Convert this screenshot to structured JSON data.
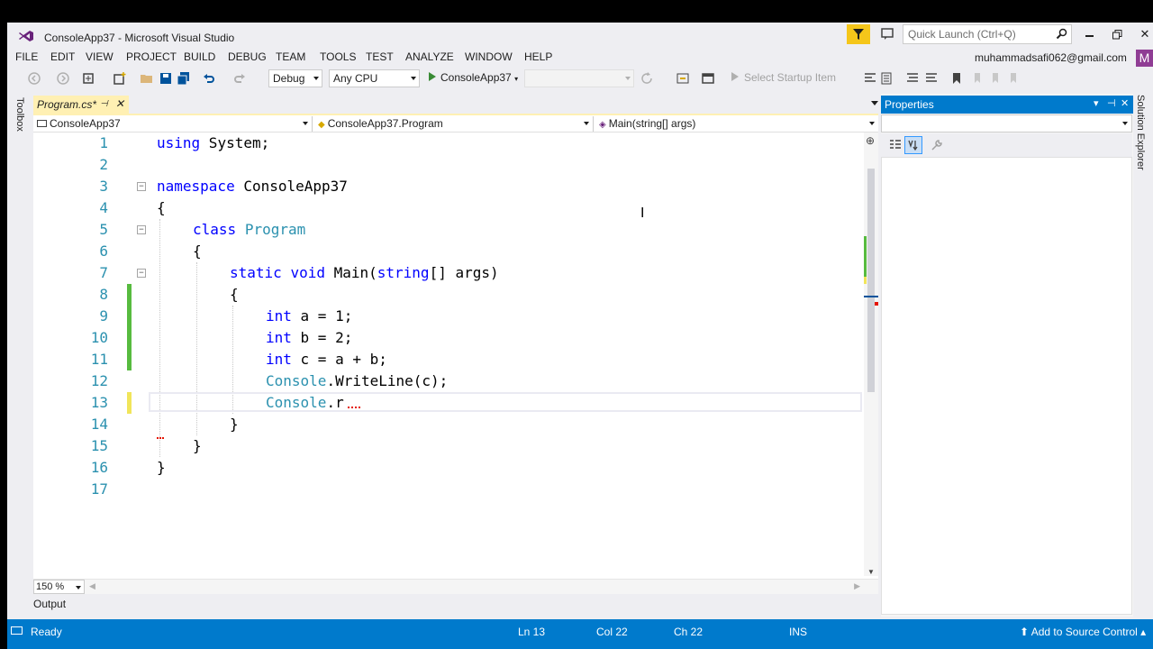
{
  "window": {
    "title": "ConsoleApp37 - Microsoft Visual Studio",
    "quick_launch_placeholder": "Quick Launch (Ctrl+Q)",
    "user_email": "muhammadsafi062@gmail.com",
    "avatar_letter": "M"
  },
  "menu": [
    "FILE",
    "EDIT",
    "VIEW",
    "PROJECT",
    "BUILD",
    "DEBUG",
    "TEAM",
    "TOOLS",
    "TEST",
    "ANALYZE",
    "WINDOW",
    "HELP"
  ],
  "toolbar": {
    "config": "Debug",
    "platform": "Any CPU",
    "start_label": "ConsoleApp37",
    "startup_item": "Select Startup Item"
  },
  "side_strip": {
    "toolbox": "Toolbox",
    "solution_explorer": "Solution Explorer"
  },
  "document_tab": {
    "label": "Program.cs*"
  },
  "navigation": {
    "project": "ConsoleApp37",
    "type": "ConsoleApp37.Program",
    "member": "Main(string[] args)"
  },
  "code_lines": [
    "using System;",
    "",
    "namespace ConsoleApp37",
    "{",
    "    class Program",
    "    {",
    "        static void Main(string[] args)",
    "        {",
    "            int a = 1;",
    "            int b = 2;",
    "            int c = a + b;",
    "            Console.WriteLine(c);",
    "            Console.r",
    "        }",
    "    }",
    "}",
    ""
  ],
  "line_numbers": [
    "1",
    "2",
    "3",
    "4",
    "5",
    "6",
    "7",
    "8",
    "9",
    "10",
    "11",
    "12",
    "13",
    "14",
    "15",
    "16",
    "17"
  ],
  "zoom": "150 %",
  "properties": {
    "title": "Properties"
  },
  "bottom_tab": "Output",
  "status": {
    "state": "Ready",
    "line": "Ln 13",
    "col": "Col 22",
    "ch": "Ch 22",
    "mode": "INS",
    "source_control": "Add to Source Control"
  },
  "colors": {
    "accent": "#007acc",
    "keyword": "#0000ff",
    "type": "#2b91af",
    "line_number": "#2b91af",
    "change_saved": "#57bb3f",
    "change_unsaved": "#f1e55a",
    "tab_active": "#fff0b3"
  }
}
